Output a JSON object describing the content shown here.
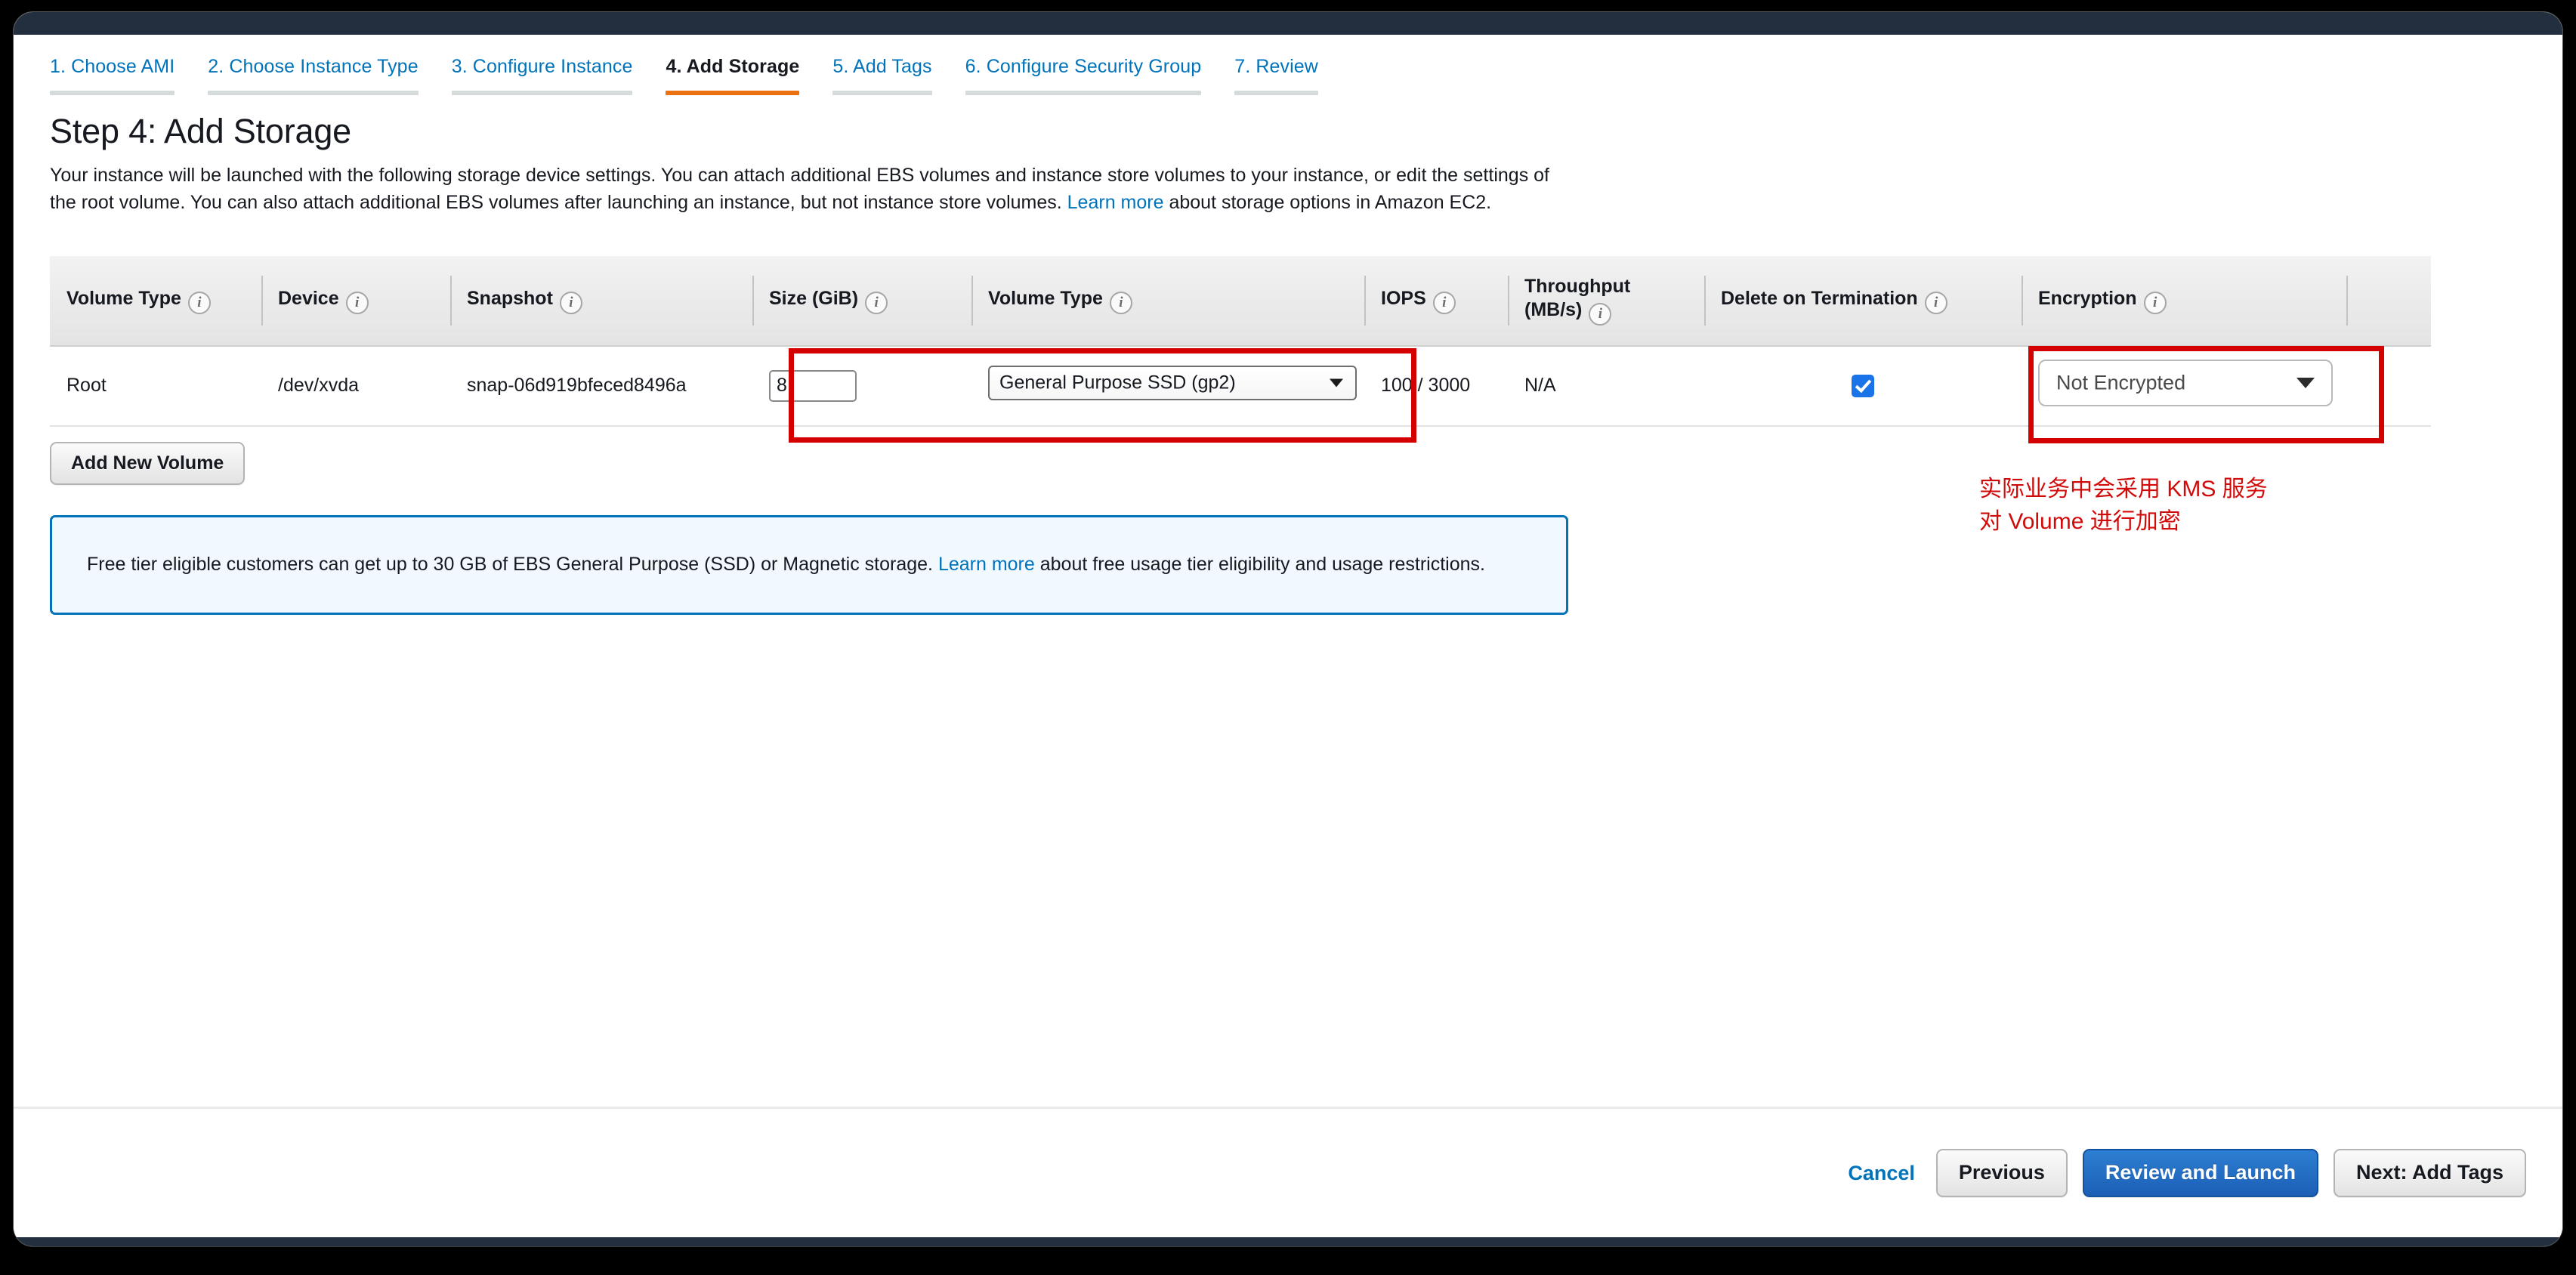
{
  "wizard": {
    "tabs": [
      {
        "label": "1. Choose AMI",
        "active": false
      },
      {
        "label": "2. Choose Instance Type",
        "active": false
      },
      {
        "label": "3. Configure Instance",
        "active": false
      },
      {
        "label": "4. Add Storage",
        "active": true
      },
      {
        "label": "5. Add Tags",
        "active": false
      },
      {
        "label": "6. Configure Security Group",
        "active": false
      },
      {
        "label": "7. Review",
        "active": false
      }
    ]
  },
  "page": {
    "title": "Step 4: Add Storage",
    "description_part1": "Your instance will be launched with the following storage device settings. You can attach additional EBS volumes and instance store volumes to your instance, or edit the settings of the root volume. You can also attach additional EBS volumes after launching an instance, but not instance store volumes. ",
    "description_link": "Learn more",
    "description_part2": " about storage options in Amazon EC2."
  },
  "table": {
    "headers": [
      "Volume Type",
      "Device",
      "Snapshot",
      "Size (GiB)",
      "Volume Type",
      "IOPS",
      "Throughput (MB/s)",
      "Delete on Termination",
      "Encryption"
    ],
    "header_throughput_line1": "Throughput",
    "header_throughput_line2": "(MB/s)",
    "info_icon": "info-icon",
    "rows": [
      {
        "volume_type": "Root",
        "device": "/dev/xvda",
        "snapshot": "snap-06d919bfeced8496a",
        "size": "8",
        "volume_type_select": "General Purpose SSD (gp2)",
        "iops": "100 / 3000",
        "throughput": "N/A",
        "delete_on_termination": true,
        "encryption_select": "Not Encrypted"
      }
    ]
  },
  "buttons": {
    "add_new_volume": "Add New Volume",
    "cancel": "Cancel",
    "previous": "Previous",
    "review_and_launch": "Review and Launch",
    "next": "Next: Add Tags"
  },
  "callout": {
    "text_part1": "Free tier eligible customers can get up to 30 GB of EBS General Purpose (SSD) or Magnetic storage. ",
    "link": "Learn more",
    "text_part2": " about free usage tier eligibility and usage restrictions."
  },
  "annotation": {
    "note": "实际业务中会采用 KMS 服务\n对 Volume 进行加密",
    "color": "#d10a0a"
  },
  "colors": {
    "accent_orange": "#ec7211",
    "link_blue": "#0073bb",
    "chrome_navy": "#232f3e",
    "highlight_red": "#d40000",
    "checkbox_blue": "#1a73e8"
  }
}
